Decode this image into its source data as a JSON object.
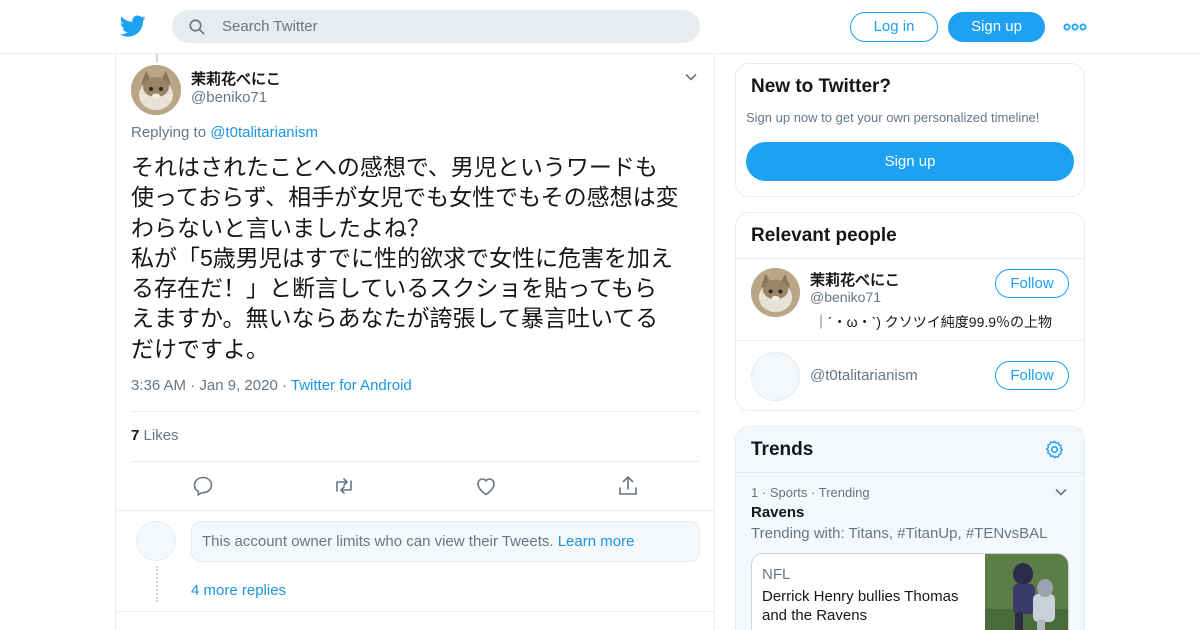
{
  "header": {
    "search_placeholder": "Search Twitter",
    "login_label": "Log in",
    "signup_label": "Sign up"
  },
  "tweet": {
    "author_name": "茉莉花べにこ",
    "author_handle": "@beniko71",
    "replying_prefix": "Replying to",
    "replying_to": "@t0talitarianism",
    "text": "それはされたことへの感想で、男児というワードも\n使っておらず、相手が女児でも女性でもその感想は変\nわらないと言いましたよね？\n私が「5歳男児はすでに性的欲求で女性に危害を加え\nる存在だ！」と断言しているスクショを貼ってもら\nえますか。無いならあなたが誇張して暴言吐いてる\nだけですよ。",
    "time": "3:36 AM",
    "date": "Jan 9, 2020",
    "source": "Twitter for Android",
    "likes_count": "7",
    "likes_label": "Likes"
  },
  "reply": {
    "limits_text": "This account owner limits who can view their Tweets.",
    "learn_more": "Learn more",
    "more_replies": "4 more replies"
  },
  "sidebar": {
    "new_to_twitter": {
      "title": "New to Twitter?",
      "subtitle": "Sign up now to get your own personalized timeline!",
      "button": "Sign up"
    },
    "relevant_people": {
      "title": "Relevant people",
      "people": [
        {
          "name": "茉莉花べにこ",
          "handle": "@beniko71",
          "bio": "｜´・ω・`) クソツイ純度99.9％の上物",
          "follow_label": "Follow"
        },
        {
          "name": "",
          "handle": "@t0talitarianism",
          "bio": "",
          "follow_label": "Follow"
        }
      ]
    },
    "trends": {
      "title": "Trends",
      "items": [
        {
          "rank": "1",
          "category": "Sports",
          "status": "Trending",
          "name": "Ravens",
          "trending_with": "Trending with: Titans, #TitanUp, #TENvsBAL",
          "news_source": "NFL",
          "news_headline": "Derrick Henry bullies Thomas and the Ravens"
        }
      ]
    }
  },
  "colors": {
    "accent": "#1da1f2",
    "link": "#1b95e0",
    "secondary_text": "#657786",
    "border": "#e6ecf0"
  },
  "icons": [
    "twitter-logo-icon",
    "search-icon",
    "more-dots-icon",
    "chevron-down-icon",
    "reply-icon",
    "retweet-icon",
    "like-icon",
    "share-icon",
    "gear-icon"
  ]
}
